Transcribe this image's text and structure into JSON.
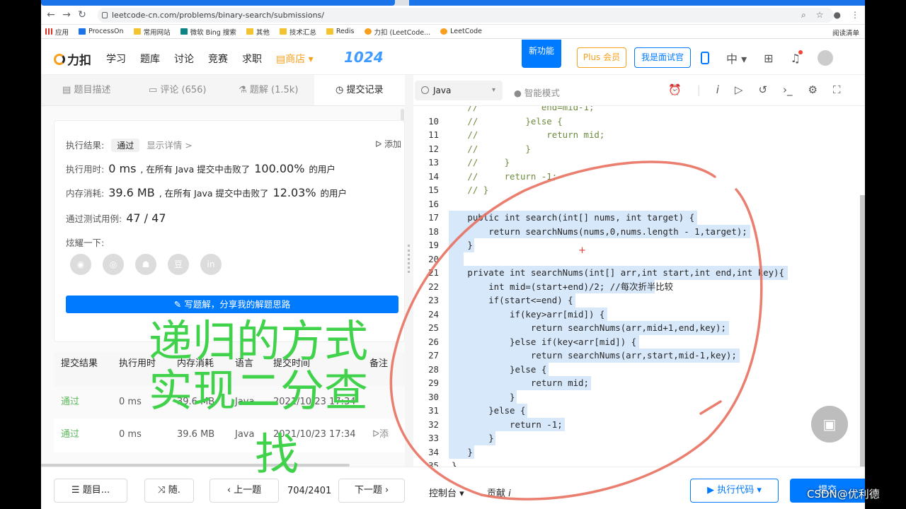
{
  "browser": {
    "url": "leetcode-cn.com/problems/binary-search/submissions/",
    "bookmarks": [
      "应用",
      "ProcessOn",
      "常用网站",
      "微软 Bing 搜索",
      "其他",
      "技术汇总",
      "Redis",
      "力扣 (LeetCode...",
      "LeetCode"
    ],
    "reading_list": "阅读清单"
  },
  "site": {
    "logo": "力扣",
    "nav": [
      "学习",
      "题库",
      "讨论",
      "竞赛",
      "求职"
    ],
    "shop": "商店",
    "event_logo": "1024",
    "new_feature": "新功能",
    "plus": "Plus 会员",
    "interviewer": "我是面试官",
    "lang_toggle": "中"
  },
  "left_tabs": [
    {
      "label": "题目描述"
    },
    {
      "label": "评论 (656)"
    },
    {
      "label": "题解 (1.5k)"
    },
    {
      "label": "提交记录"
    }
  ],
  "result": {
    "label": "执行结果:",
    "status": "通过",
    "details": "显示详情 >",
    "add_note": "添加",
    "time_label": "执行用时:",
    "time_value": "0 ms",
    "time_text": ", 在所有 Java 提交中击败了",
    "time_pct": "100.00%",
    "users": "的用户",
    "mem_label": "内存消耗:",
    "mem_value": "39.6 MB",
    "mem_text": ", 在所有 Java 提交中击败了",
    "mem_pct": "12.03%",
    "cases_label": "通过测试用例:",
    "cases_value": "47 / 47",
    "share_label": "炫耀一下:",
    "write_button": "写题解，分享我的解题思路"
  },
  "submissions": {
    "headers": [
      "提交结果",
      "执行用时",
      "内存消耗",
      "语言",
      "提交时间",
      "备注"
    ],
    "rows": [
      [
        "通过",
        "0 ms",
        "39.6 MB",
        "Java",
        "2021/10/23 17:34"
      ],
      [
        "通过",
        "0 ms",
        "39.6 MB",
        "Java",
        "2021/10/23 17:34"
      ]
    ],
    "add_note": "添"
  },
  "editor": {
    "language": "Java",
    "smart_mode": "智能模式",
    "lines": [
      {
        "n": "",
        "t": "   //            end=mid-1;",
        "sel": false
      },
      {
        "n": "10",
        "t": "   //         }else {",
        "sel": false
      },
      {
        "n": "11",
        "t": "   //             return mid;",
        "sel": false
      },
      {
        "n": "12",
        "t": "   //         }",
        "sel": false
      },
      {
        "n": "13",
        "t": "   //     }",
        "sel": false
      },
      {
        "n": "14",
        "t": "   //     return -1;",
        "sel": false
      },
      {
        "n": "15",
        "t": "   // }",
        "sel": false
      },
      {
        "n": "16",
        "t": "",
        "sel": false
      },
      {
        "n": "17",
        "t": "   public int search(int[] nums, int target) {",
        "sel": true
      },
      {
        "n": "18",
        "t": "       return searchNums(nums,0,nums.length - 1,target);",
        "sel": true
      },
      {
        "n": "19",
        "t": "   }",
        "sel": true
      },
      {
        "n": "20",
        "t": "",
        "sel": true
      },
      {
        "n": "21",
        "t": "   private int searchNums(int[] arr,int start,int end,int key){",
        "sel": true
      },
      {
        "n": "22",
        "t": "       int mid=(start+end)/2; //每次折半比较",
        "sel": true
      },
      {
        "n": "23",
        "t": "       if(start<=end) {",
        "sel": true
      },
      {
        "n": "24",
        "t": "           if(key>arr[mid]) {",
        "sel": true
      },
      {
        "n": "25",
        "t": "               return searchNums(arr,mid+1,end,key);",
        "sel": true
      },
      {
        "n": "26",
        "t": "           }else if(key<arr[mid]) {",
        "sel": true
      },
      {
        "n": "27",
        "t": "               return searchNums(arr,start,mid-1,key);",
        "sel": true
      },
      {
        "n": "28",
        "t": "           }else {",
        "sel": true
      },
      {
        "n": "29",
        "t": "               return mid;",
        "sel": true
      },
      {
        "n": "30",
        "t": "           }",
        "sel": true
      },
      {
        "n": "31",
        "t": "       }else {",
        "sel": true
      },
      {
        "n": "32",
        "t": "           return -1;",
        "sel": true
      },
      {
        "n": "33",
        "t": "       }",
        "sel": true
      },
      {
        "n": "34",
        "t": "   }",
        "sel": true
      },
      {
        "n": "35",
        "t": "}",
        "sel": false
      }
    ]
  },
  "bottom": {
    "problems": "题目...",
    "random": "随.",
    "prev": "上一题",
    "page": "704/2401",
    "next": "下一题",
    "console": "控制台",
    "contribute": "贡献",
    "run": "执行代码",
    "submit": "提交"
  },
  "overlay": {
    "line1": "递归的方式",
    "line2": "实现二分查",
    "line3": "找",
    "color": "#3fd24a"
  },
  "watermark": "CSDN@优利德",
  "colors": {
    "accent": "#007aff",
    "brand_orange": "#f89f1b",
    "pass_green": "#5cb85c",
    "annotation_red": "#e8705f"
  }
}
